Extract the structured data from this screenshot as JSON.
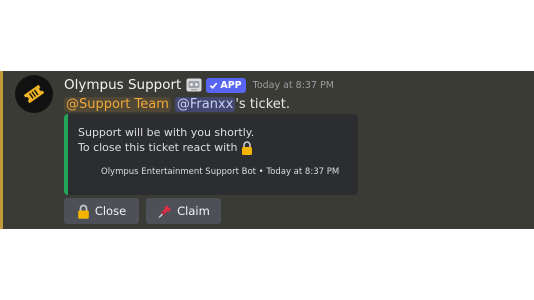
{
  "message": {
    "author": "Olympus Support",
    "app_tag": "APP",
    "timestamp": "Today at 8:37 PM",
    "content": {
      "role_mention": "@Support Team",
      "user_mention": "@Franxx",
      "suffix": "'s ticket."
    }
  },
  "embed": {
    "line1": "Support will be with you shortly.",
    "line2": "To close this ticket react with",
    "footer": "Olympus Entertainment Support Bot • Today at 8:37 PM",
    "accent_color": "#23a55a"
  },
  "buttons": {
    "close_label": "Close",
    "claim_label": "Claim"
  },
  "icons": {
    "avatar": "ticket-icon",
    "bot": "robot-emoji-icon",
    "app": "checkmark-icon",
    "lock": "lock-icon",
    "pin": "pushpin-icon"
  },
  "colors": {
    "message_bg": "#3b3b35",
    "highlight_bar": "#c29a3a",
    "role_mention": "#f0a83a",
    "app_tag": "#5865f2",
    "button": "#4e5058"
  }
}
